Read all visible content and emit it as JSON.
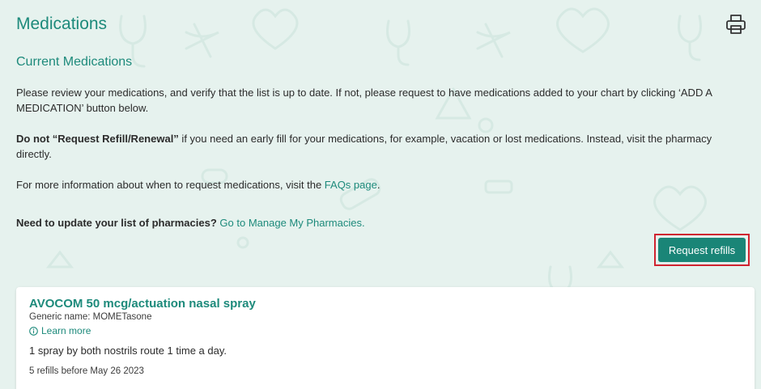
{
  "page": {
    "title": "Medications",
    "print_icon": "printer-icon"
  },
  "section": {
    "title": "Current Medications"
  },
  "paragraphs": {
    "review": "Please review your medications, and verify that the list is up to date. If not, please request to have medications added to your chart by clicking ‘ADD A MEDICATION’ button below.",
    "refill_bold": "Do not “Request Refill/Renewal”",
    "refill_rest": " if you need an early fill for your medications, for example, vacation or lost medications. Instead, visit the pharmacy directly.",
    "info_prefix": "For more information about when to request medications, visit the ",
    "faqs_link": "FAQs page",
    "info_suffix": ".",
    "pharmacy_bold": "Need to update your list of pharmacies?",
    "pharmacy_link": "Go to Manage My Pharmacies."
  },
  "actions": {
    "request_refills_label": "Request refills"
  },
  "medications": [
    {
      "name": "AVOCOM 50 mcg/actuation nasal spray",
      "generic": "Generic name: MOMETasone",
      "learn_more": "Learn more",
      "instructions": "1 spray by both nostrils route 1 time a day.",
      "refills": "5 refills before May 26 2023"
    }
  ],
  "colors": {
    "accent": "#1d8a7b",
    "background": "#e6f2ee",
    "button": "#1a8577",
    "highlight_border": "#d0232f"
  }
}
